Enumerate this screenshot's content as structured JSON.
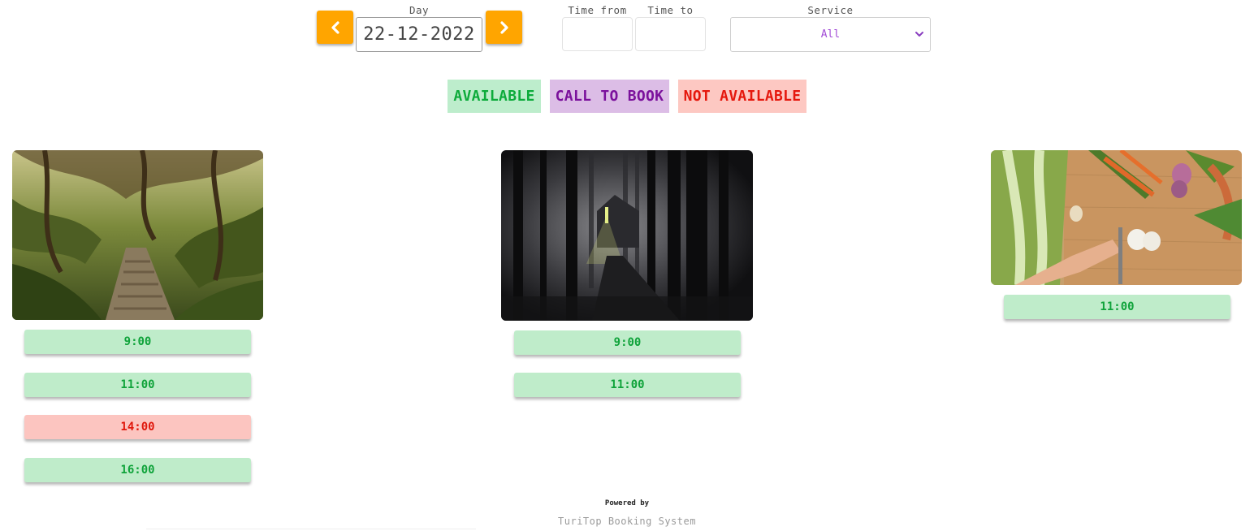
{
  "filters": {
    "day_label": "Day",
    "day_value": "22-12-2022",
    "time_from_label": "Time from",
    "time_from_value": "",
    "time_to_label": "Time to",
    "time_to_value": "",
    "service_label": "Service",
    "service_value": "All",
    "prev_icon": "chevron-left-icon",
    "next_icon": "chevron-right-icon"
  },
  "legend": {
    "available": "AVAILABLE",
    "call_to_book": "CALL TO BOOK",
    "not_available": "NOT AVAILABLE"
  },
  "cards": [
    {
      "image": "mossy-forest-path",
      "slots": [
        {
          "time": "9:00",
          "status": "available"
        },
        {
          "time": "11:00",
          "status": "available"
        },
        {
          "time": "14:00",
          "status": "not_available"
        },
        {
          "time": "16:00",
          "status": "available"
        }
      ]
    },
    {
      "image": "dark-foggy-forest-cabin",
      "slots": [
        {
          "time": "9:00",
          "status": "available"
        },
        {
          "time": "11:00",
          "status": "available"
        }
      ]
    },
    {
      "image": "vegetables-cutting-board",
      "slots": [
        {
          "time": "11:00",
          "status": "available"
        }
      ]
    }
  ],
  "footer": {
    "powered_by": "Powered by",
    "brand": "TuriTop Booking System"
  },
  "colors": {
    "accent": "#ffa500",
    "available_bg": "#bfecca",
    "available_text": "#0fa33a",
    "call_bg": "#dcbde6",
    "call_text": "#7b119c",
    "not_available_bg": "#fcc5c0",
    "not_available_text": "#e0180c",
    "service_text": "#a24cd6"
  }
}
